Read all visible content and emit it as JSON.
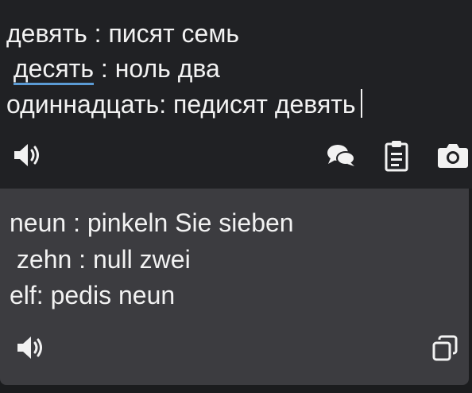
{
  "source": {
    "lines": [
      {
        "text": "девять : писят семь"
      },
      {
        "prefix": " ",
        "underlined": "десять",
        "rest": " : ноль два"
      },
      {
        "text": "одиннадцать: педисят девять"
      }
    ],
    "icons": {
      "speaker": "speaker-icon",
      "conversation": "conversation-icon",
      "clipboard": "clipboard-icon",
      "camera": "camera-icon"
    }
  },
  "translation": {
    "lines": [
      "neun : pinkeln Sie sieben",
      " zehn : null zwei",
      "elf: pedis neun"
    ],
    "icons": {
      "speaker": "speaker-icon",
      "copy": "copy-icon"
    }
  },
  "colors": {
    "source_bg": "#202124",
    "target_bg": "#3c3c40",
    "text": "#f2f2f2",
    "underline_accent": "#5b9bd5"
  }
}
